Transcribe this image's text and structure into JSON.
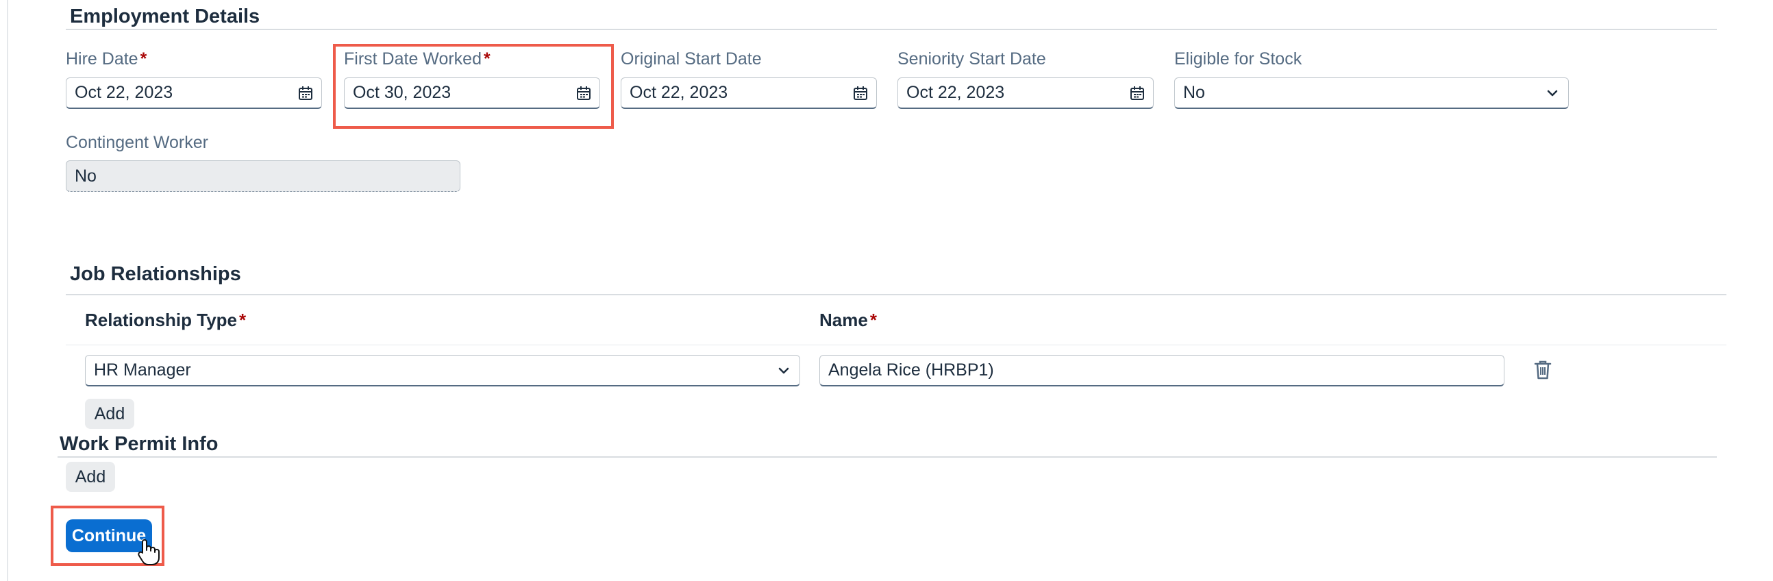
{
  "employment": {
    "title": "Employment Details",
    "hire_date": {
      "label": "Hire Date",
      "value": "Oct 22, 2023",
      "icon": "calendar-icon"
    },
    "first_date_worked": {
      "label": "First Date Worked",
      "value": "Oct 30, 2023",
      "icon": "calendar-icon"
    },
    "original_start_date": {
      "label": "Original Start Date",
      "value": "Oct 22, 2023",
      "icon": "calendar-icon"
    },
    "seniority_start_date": {
      "label": "Seniority Start Date",
      "value": "Oct 22, 2023",
      "icon": "calendar-icon"
    },
    "eligible_for_stock": {
      "label": "Eligible for Stock",
      "value": "No",
      "icon": "chevron-down-icon"
    },
    "contingent_worker": {
      "label": "Contingent Worker",
      "value": "No"
    },
    "required_mark": "*"
  },
  "job_relationships": {
    "title": "Job Relationships",
    "col_relationship_type": "Relationship Type",
    "col_name": "Name",
    "rows": [
      {
        "relationship_type": "HR Manager",
        "name": "Angela Rice (HRBP1)"
      }
    ],
    "add_label": "Add",
    "delete_icon": "trash-icon"
  },
  "work_permit": {
    "title": "Work Permit Info",
    "add_label": "Add"
  },
  "footer": {
    "continue_label": "Continue"
  },
  "colors": {
    "accent": "#0a6ed1",
    "required": "#aa0808",
    "highlight": "#ee5b4a",
    "label": "#556b82"
  }
}
